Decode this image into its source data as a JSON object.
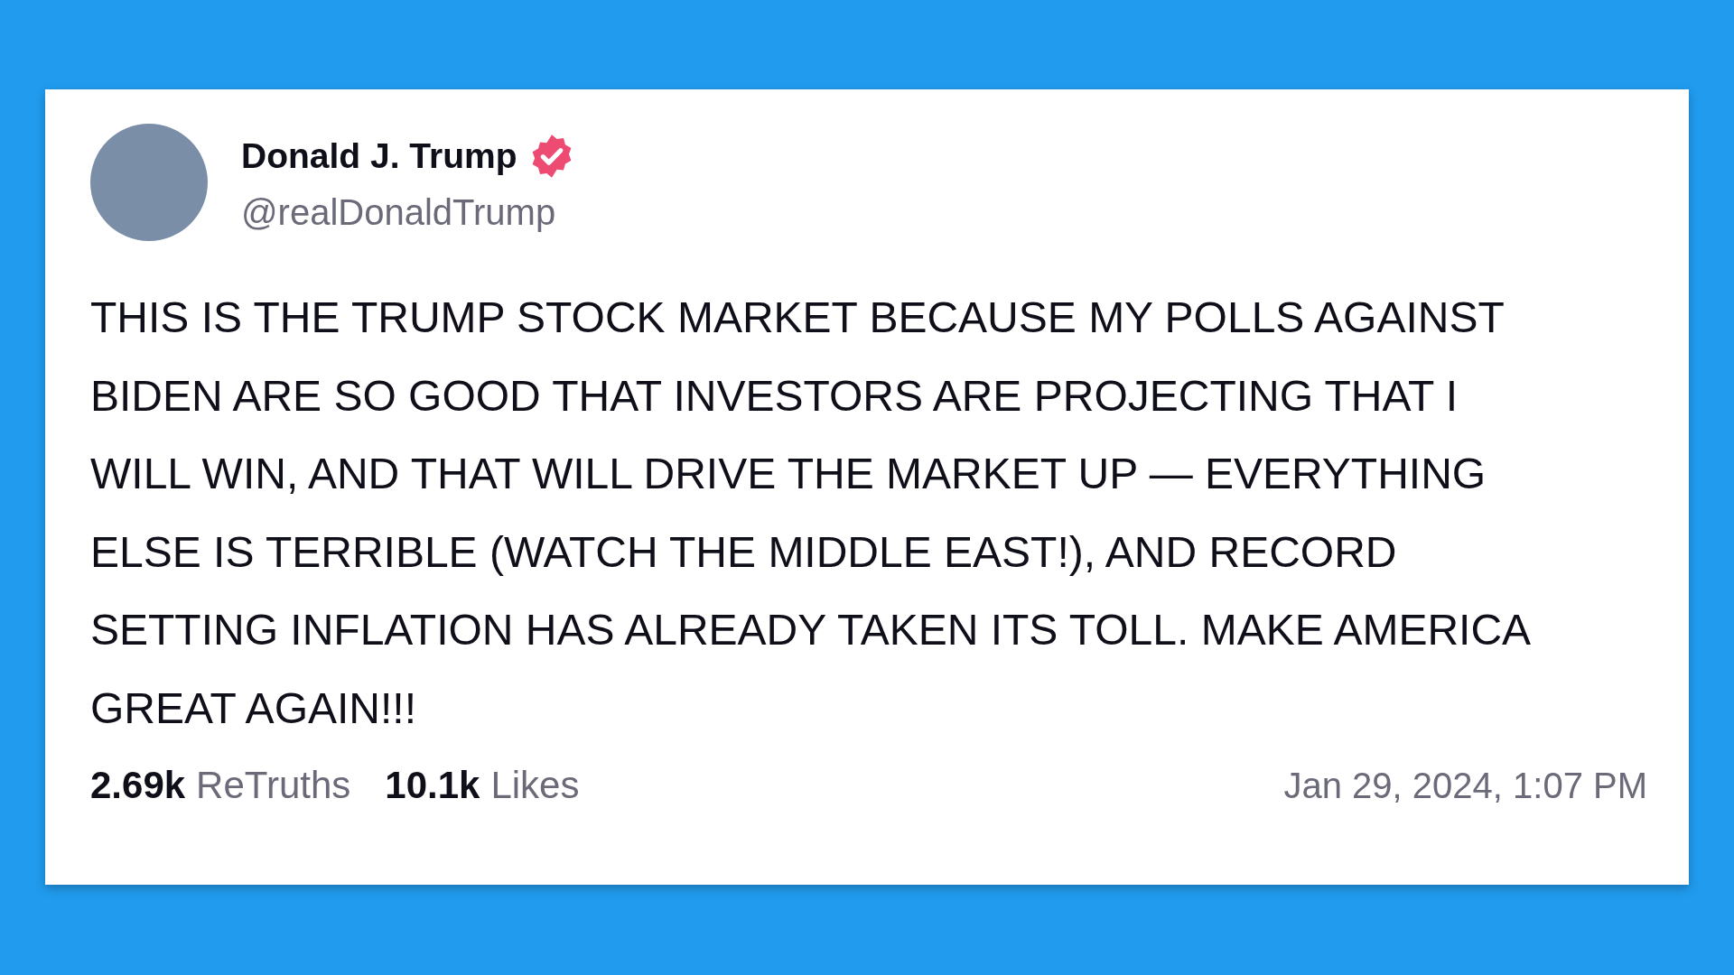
{
  "post": {
    "author": {
      "name": "Donald J. Trump",
      "verified": true,
      "handle": "@realDonaldTrump"
    },
    "text": "THIS IS THE TRUMP STOCK MARKET BECAUSE MY POLLS AGAINST BIDEN ARE SO GOOD THAT INVESTORS ARE PROJECTING THAT I WILL WIN, AND THAT WILL DRIVE THE MARKET UP — EVERYTHING ELSE IS TERRIBLE (WATCH THE MIDDLE EAST!), AND RECORD SETTING INFLATION HAS ALREADY TAKEN ITS TOLL. MAKE AMERICA GREAT AGAIN!!!",
    "stats": [
      {
        "count": "2.69k",
        "label": "ReTruths"
      },
      {
        "count": "10.1k",
        "label": "Likes"
      }
    ],
    "timestamp": "Jan 29, 2024, 1:07 PM"
  }
}
